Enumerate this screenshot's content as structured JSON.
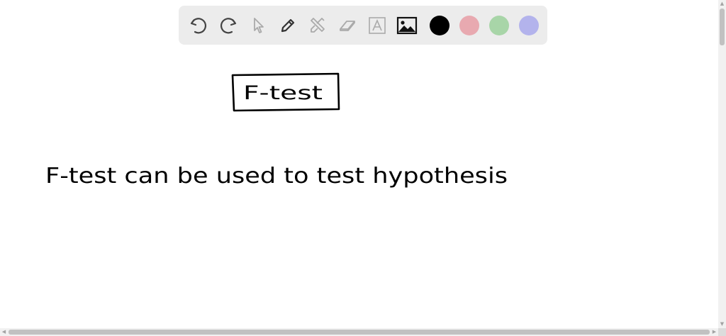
{
  "toolbar": {
    "tools": [
      {
        "name": "undo-icon"
      },
      {
        "name": "redo-icon"
      },
      {
        "name": "select-pointer-icon"
      },
      {
        "name": "pen-icon"
      },
      {
        "name": "tools-icon"
      },
      {
        "name": "eraser-icon"
      },
      {
        "name": "text-tool-icon"
      },
      {
        "name": "image-insert-icon"
      }
    ],
    "colors": [
      "#000000",
      "#e8a9b0",
      "#a8d5a8",
      "#b3b3ec"
    ]
  },
  "canvas": {
    "title_box_text": "F-test",
    "body_text": "F-test can be used to test hypothesis"
  }
}
